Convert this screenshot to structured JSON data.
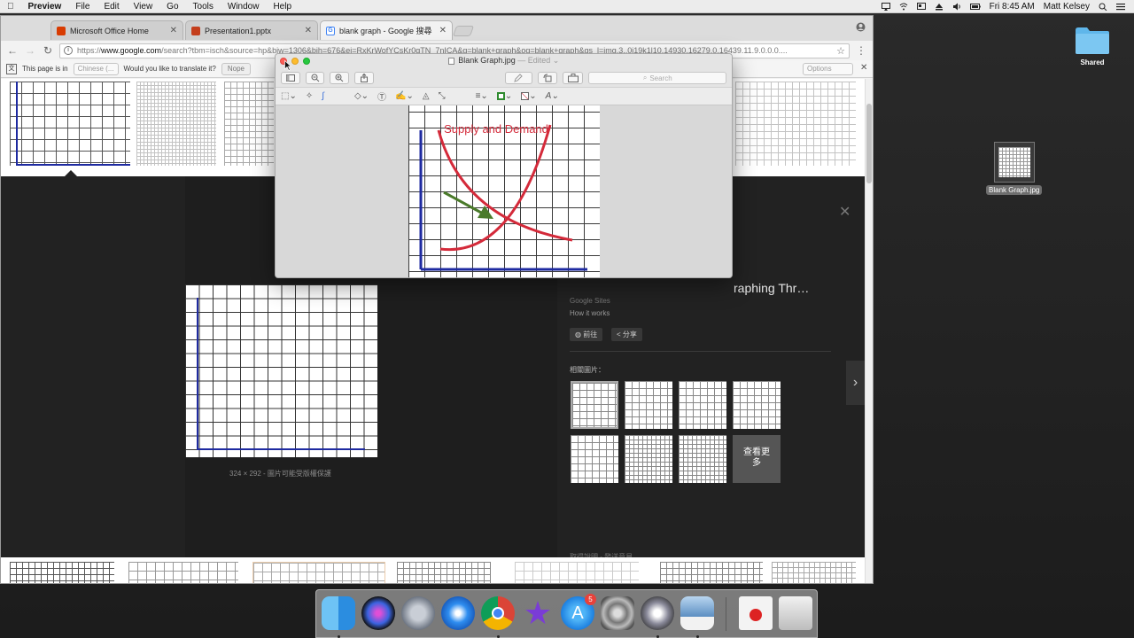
{
  "menubar": {
    "app_name": "Preview",
    "items": [
      "File",
      "Edit",
      "View",
      "Go",
      "Tools",
      "Window",
      "Help"
    ],
    "clock": "Fri 8:45 AM",
    "user": "Matt Kelsey"
  },
  "desktop": {
    "shared_label": "Shared",
    "file_label": "Blank Graph.jpg"
  },
  "browser": {
    "tabs": [
      {
        "title": "Microsoft Office Home",
        "color": "#d83b01"
      },
      {
        "title": "Presentation1.pptx",
        "color": "#c43e1c"
      },
      {
        "title": "blank graph - Google 搜尋",
        "color": "#4285f4"
      }
    ],
    "url_prefix": "https://",
    "url_domain": "www.google.com",
    "url_rest": "/search?tbm=isch&source=hp&biw=1306&bih=676&ei=RxKrWofYCsKr0gTN_7nICA&q=blank+graph&oq=blank+graph&gs_l=img.3..0i19k1l10.14930.16279.0.16439.11.9.0.0.0....",
    "translate": {
      "prefix": "This page is in",
      "language": "Chinese (...",
      "question": "Would you like to translate it?",
      "nope": "Nope",
      "options": "Options"
    },
    "viewer": {
      "title_fragment": "raphing Thr…",
      "source": "Google Sites",
      "how_it_works": "How it works",
      "visit_button": "前往",
      "share_button": "分享",
      "related_label": "相關圖片：",
      "see_more": "查看更多",
      "image_meta_size": "324 × 292",
      "image_meta_note": "圖片可能受版權保護",
      "footer_links": "取得說明 - 發送意見"
    }
  },
  "preview": {
    "title": "Blank Graph.jpg",
    "edited": "— Edited ⌄",
    "search_placeholder": "Search",
    "graph_title": "Supply and Demand",
    "colors": {
      "curve": "#d42a3a",
      "arrow": "#4a7a2a",
      "axis": "#1e2aa0"
    }
  },
  "dock": {
    "appstore_badge": "5"
  }
}
